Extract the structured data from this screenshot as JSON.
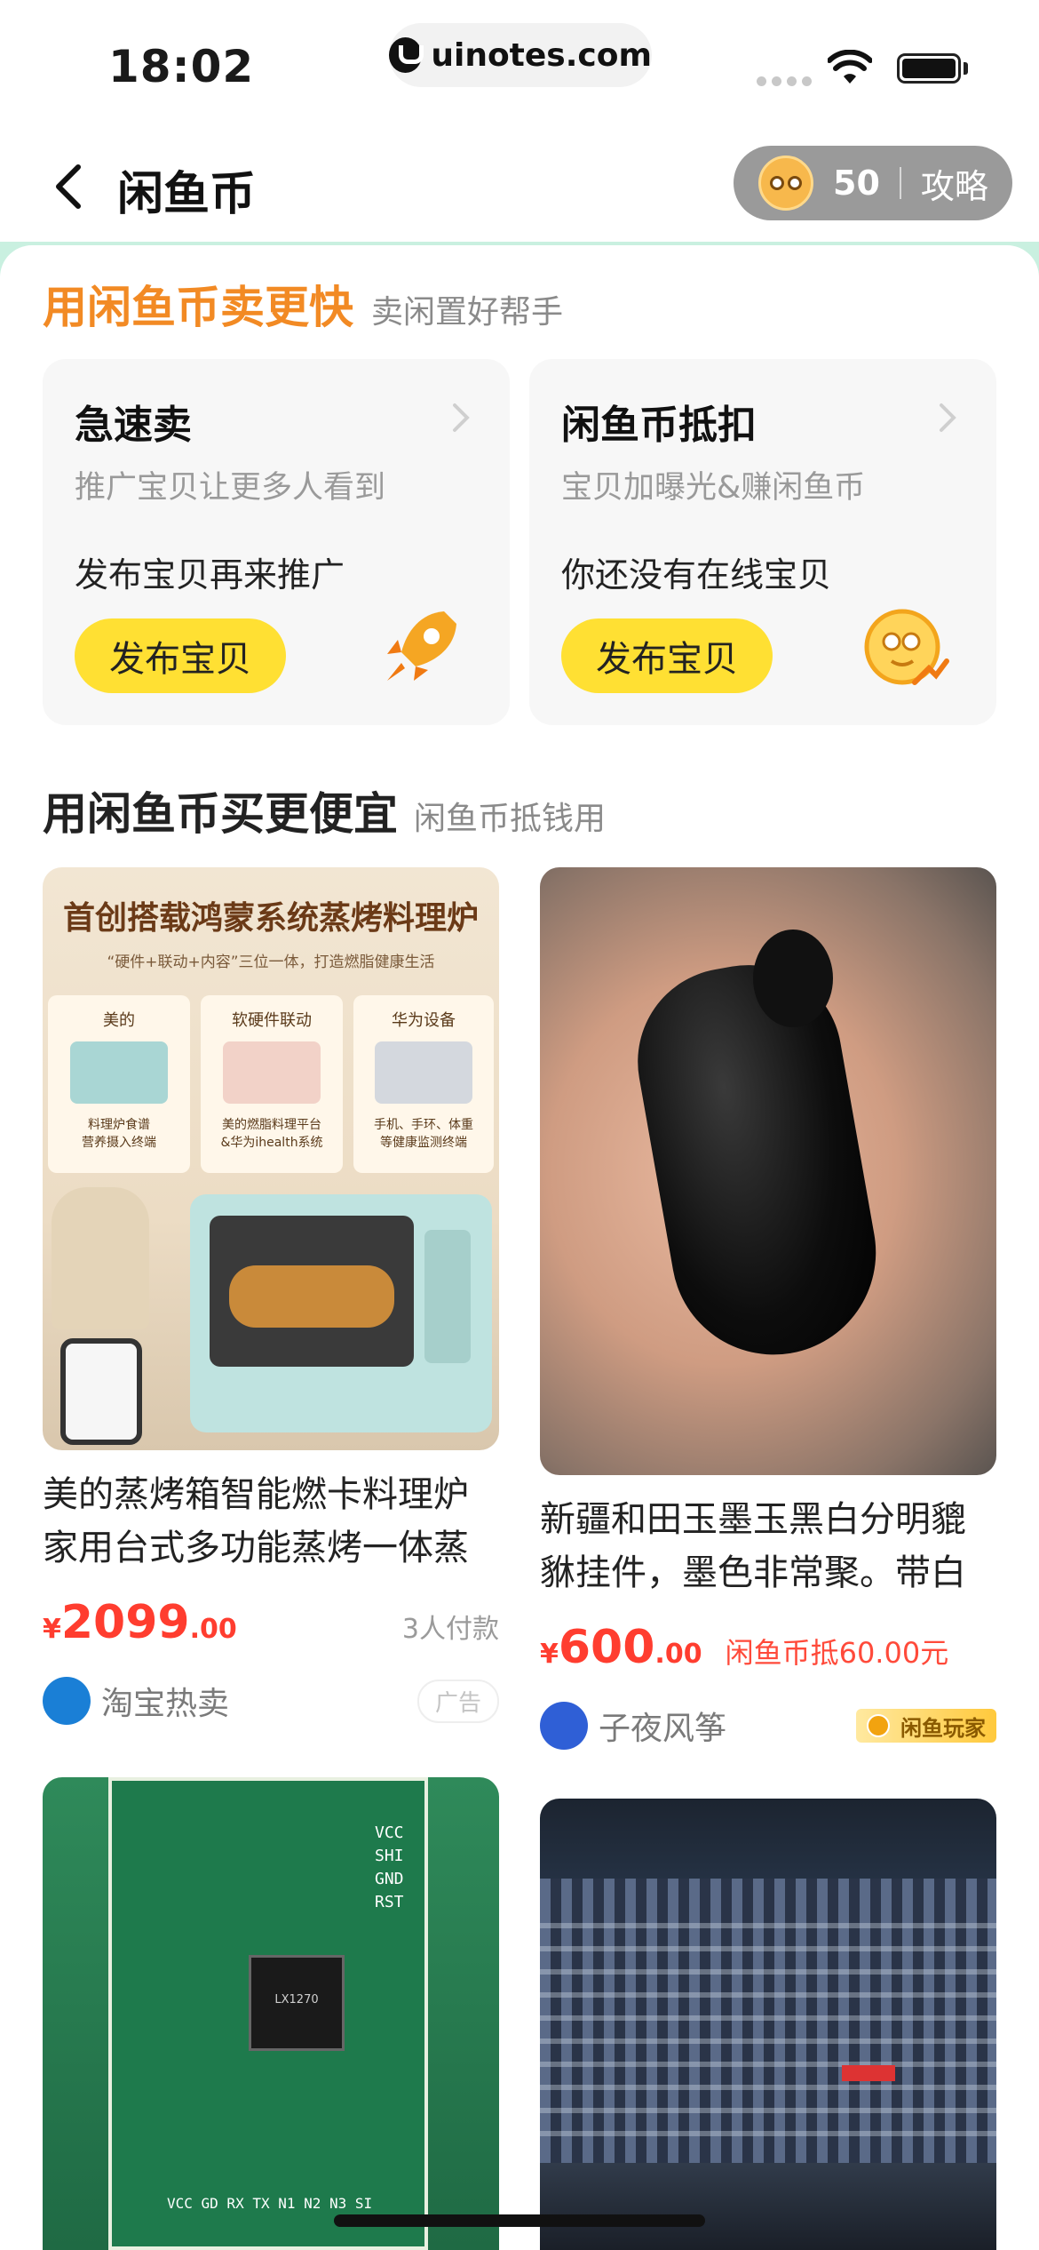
{
  "status_bar": {
    "time": "18:02",
    "url": "uinotes.com"
  },
  "nav": {
    "title": "闲鱼币",
    "coin_count": "50",
    "guide_label": "攻略"
  },
  "sell_section": {
    "title": "用闲鱼币卖更快",
    "subtitle": "卖闲置好帮手",
    "cards": [
      {
        "title": "急速卖",
        "desc": "推广宝贝让更多人看到",
        "status": "发布宝贝再来推广",
        "button": "发布宝贝",
        "icon": "rocket-icon"
      },
      {
        "title": "闲鱼币抵扣",
        "desc": "宝贝加曝光&赚闲鱼币",
        "status": "你还没有在线宝贝",
        "button": "发布宝贝",
        "icon": "coin-icon"
      }
    ]
  },
  "buy_section": {
    "title": "用闲鱼币买更便宜",
    "subtitle": "闲鱼币抵钱用"
  },
  "products": [
    {
      "image_text": {
        "headline": "首创搭载鸿蒙系统蒸烤料理炉",
        "tagline": "“硬件+联动+内容”三位一体，打造燃脂健康生活",
        "col1_title": "美的",
        "col1_desc": "料理炉食谱\n营养摄入终端",
        "col2_title": "软硬件联动",
        "col2_desc": "美的燃脂料理平台\n&华为ihealth系统",
        "col3_title": "华为设备",
        "col3_desc": "手机、手环、体重\n等健康监测终端"
      },
      "title": "美的蒸烤箱智能燃卡料理炉家用台式多功能蒸烤一体蒸",
      "price_symbol": "¥",
      "price_int": "2099",
      "price_dec": ".00",
      "payers": "3人付款",
      "seller": "淘宝热卖",
      "badge": "广告"
    },
    {
      "title": "新疆和田玉墨玉黑白分明貔貅挂件，墨色非常聚。带白",
      "price_symbol": "¥",
      "price_int": "600",
      "price_dec": ".00",
      "deduct": "闲鱼币抵60.00元",
      "seller": "子夜风筝",
      "badge": "闲鱼玩家"
    },
    {
      "image_text": {
        "pins_right": [
          "VCC",
          "SHI",
          "GND",
          "RST"
        ],
        "pins_bottom": "VCC GD RX TX N1 N2 N3 SI",
        "chip_label": "LX1270"
      }
    },
    {}
  ],
  "colors": {
    "accent_orange": "#f28a24",
    "price_red": "#ff3d2f",
    "button_yellow": "#ffe033",
    "sheet_mint": "#c9f0e0"
  }
}
